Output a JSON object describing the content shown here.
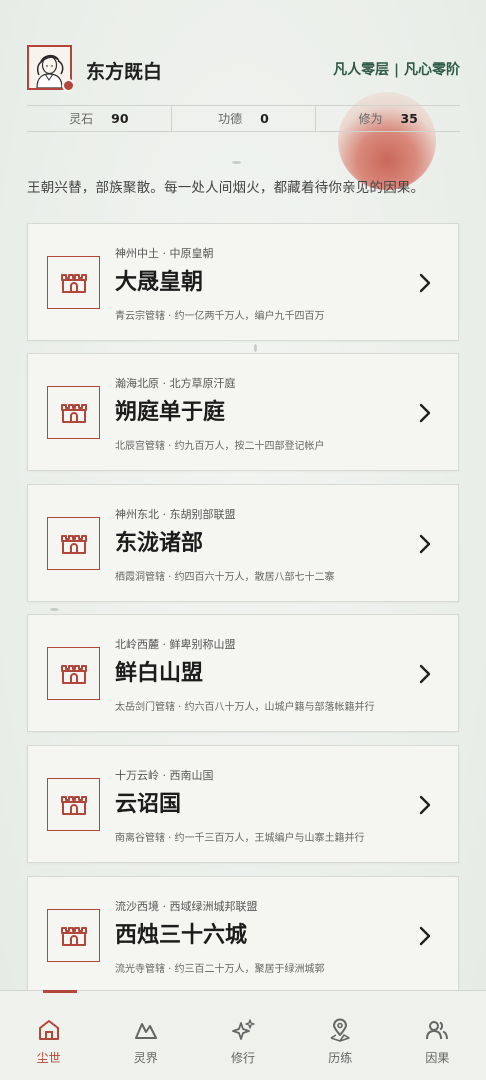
{
  "profile": {
    "name": "东方既白",
    "realm": "凡人零层 | 凡心零阶"
  },
  "stats": [
    {
      "label": "灵石",
      "value": "90"
    },
    {
      "label": "功德",
      "value": "0"
    },
    {
      "label": "修为",
      "value": "35"
    }
  ],
  "motto": "王朝兴替，部族聚散。每一处人间烟火，都藏着待你亲见的因果。",
  "dynasties": [
    {
      "region": "神州中土 · 中原皇朝",
      "title": "大晟皇朝",
      "desc": "青云宗管辖 · 约一亿两千万人，编户九千四百万"
    },
    {
      "region": "瀚海北原 · 北方草原汗庭",
      "title": "朔庭单于庭",
      "desc": "北辰宫管辖 · 约九百万人，按二十四部登记帐户"
    },
    {
      "region": "神州东北 · 东胡别部联盟",
      "title": "东泷诸部",
      "desc": "栖霞洞管辖 · 约四百六十万人，散居八部七十二寨"
    },
    {
      "region": "北岭西麓 · 鲜卑别称山盟",
      "title": "鲜白山盟",
      "desc": "太岳剑门管辖 · 约六百八十万人，山城户籍与部落帐籍并行"
    },
    {
      "region": "十万云岭 · 西南山国",
      "title": "云诏国",
      "desc": "南离谷管辖 · 约一千三百万人，王城编户与山寨土籍并行"
    },
    {
      "region": "流沙西境 · 西域绿洲城邦联盟",
      "title": "西烛三十六城",
      "desc": "流光寺管辖 · 约三百二十万人，聚居于绿洲城郭"
    }
  ],
  "tabs": [
    {
      "label": "尘世",
      "icon": "home-icon",
      "active": true
    },
    {
      "label": "灵界",
      "icon": "mountain-icon",
      "active": false
    },
    {
      "label": "修行",
      "icon": "sparkle-icon",
      "active": false
    },
    {
      "label": "历练",
      "icon": "map-pin-icon",
      "active": false
    },
    {
      "label": "因果",
      "icon": "people-icon",
      "active": false
    }
  ],
  "colors": {
    "accent": "#b3463a",
    "realm_text": "#2f5a48",
    "background": "#eef1ed"
  }
}
